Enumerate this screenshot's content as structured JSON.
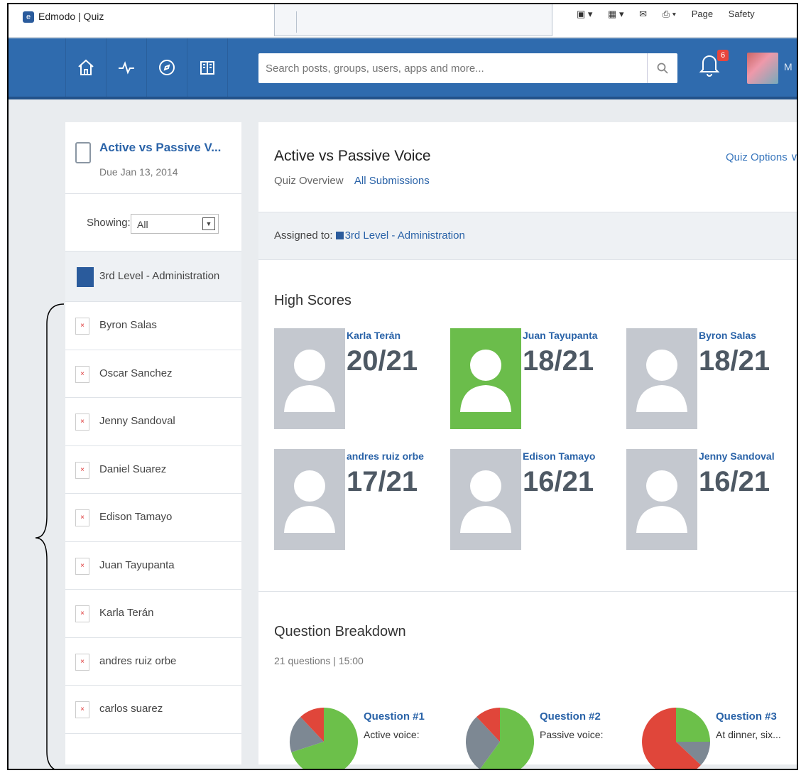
{
  "browser": {
    "tab_title": "Edmodo | Quiz",
    "commands": [
      "Page",
      "Safety"
    ]
  },
  "nav": {
    "search_placeholder": "Search posts, groups, users, apps and more...",
    "notification_count": "6",
    "user_short": "M"
  },
  "sidebar": {
    "quiz_title": "Active vs Passive V...",
    "due": "Due Jan 13, 2014",
    "showing_label": "Showing:",
    "showing_value": "All",
    "group": "3rd Level - Administration",
    "students": [
      "Byron Salas",
      "Oscar Sanchez",
      "Jenny Sandoval",
      "Daniel Suarez",
      "Edison Tamayo",
      "Juan Tayupanta",
      "Karla Terán",
      "andres ruiz orbe",
      "carlos suarez"
    ]
  },
  "main": {
    "title": "Active vs Passive Voice",
    "tabs": {
      "overview": "Quiz Overview",
      "submissions": "All Submissions"
    },
    "options": "Quiz Options ∨",
    "assigned_label": "Assigned to:",
    "assigned_group": "3rd Level - Administration",
    "high_scores_title": "High Scores",
    "high_scores": [
      {
        "name": "Karla Terán",
        "score": "20/21",
        "photo": "gray"
      },
      {
        "name": "Juan Tayupanta",
        "score": "18/21",
        "photo": "green"
      },
      {
        "name": "Byron Salas",
        "score": "18/21",
        "photo": "gray"
      },
      {
        "name": "andres ruiz orbe",
        "score": "17/21",
        "photo": "gray"
      },
      {
        "name": "Edison Tamayo",
        "score": "16/21",
        "photo": "gray"
      },
      {
        "name": "Jenny Sandoval",
        "score": "16/21",
        "photo": "gray"
      }
    ],
    "breakdown_title": "Question Breakdown",
    "breakdown_sub": "21 questions | 15:00",
    "questions": [
      {
        "title": "Question #1",
        "desc": "Active voice:",
        "slices": [
          0.7,
          0.18,
          0.12
        ]
      },
      {
        "title": "Question #2",
        "desc": "Passive voice:",
        "slices": [
          0.6,
          0.28,
          0.12
        ]
      },
      {
        "title": "Question #3",
        "desc": "At dinner, six...",
        "slices": [
          0.25,
          0.12,
          0.63
        ]
      }
    ],
    "pie_colors": [
      "#6cc04a",
      "#7d8893",
      "#e0463a"
    ]
  }
}
